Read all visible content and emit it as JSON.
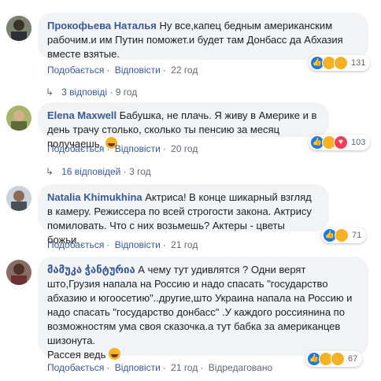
{
  "colors": {
    "author": "#385898",
    "bubble": "#f2f3f5",
    "meta": "#606770",
    "like": "#1877f2",
    "haha": "#f7b125",
    "love": "#f33e58"
  },
  "comments": [
    {
      "author": "Прокофьева Наталья",
      "text": "Ну все,капец бедным американским рабочим.и им Путин поможет.и будет там Донбасс да Абхазия вместе взятые.",
      "reactions": [
        "like-icon",
        "haha-icon",
        "sad-icon"
      ],
      "reaction_count": "131",
      "like": "Подобається",
      "reply": "Відповісти",
      "time": "22 год",
      "replies": "3 відповіді",
      "replies_time": "9 год"
    },
    {
      "author": "Elena Maxwell",
      "text": "Бабушка, не плачь. Я живу в Америке и в день трачу столько, сколько ты пенсию за месяц получаешь.",
      "reactions": [
        "like-icon",
        "haha-icon",
        "love-icon"
      ],
      "reaction_count": "103",
      "like": "Подобається",
      "reply": "Відповісти",
      "time": "20 год",
      "replies": "16 відповідей",
      "replies_time": "3 год"
    },
    {
      "author": "Natalia Khimukhina",
      "text": "Актриса! В конце шикарный взгляд в камеру. Режиссера по всей строгости закона. Актрису помиловать. Что с них возьмешь? Актеры - цветы божьи.",
      "reactions": [
        "like-icon",
        "haha-icon"
      ],
      "reaction_count": "71",
      "like": "Подобається",
      "reply": "Відповісти",
      "time": "21 год"
    },
    {
      "author": "მამუკა ჭანტურია",
      "text": "А чему тут удивлятся ? Одни верят што,Грузия напала на Россию и надо спасать \"государство абхазию и югоосетию\"..другие,што Украина напала на Россию и надо спасать \"государство донбасс\" .У каждого россиянина по возможностям ума своя сказочка.а тут бабка за американцев шизонута.",
      "text2": "Рассея ведь",
      "reactions": [
        "like-icon",
        "haha-icon",
        "sad-icon"
      ],
      "reaction_count": "67",
      "like": "Подобається",
      "reply": "Відповісти",
      "time": "21 год",
      "edited": "Відредаговано"
    }
  ],
  "separator": "·"
}
